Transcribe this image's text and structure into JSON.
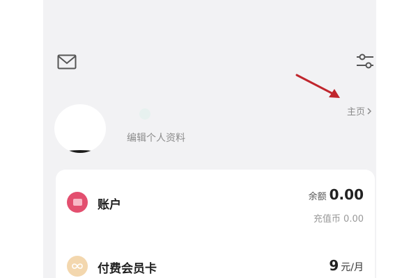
{
  "header": {
    "mail_icon": "mail-icon",
    "settings_icon": "sliders-icon",
    "homepage_label": "主页"
  },
  "profile": {
    "edit_label": "编辑个人资料"
  },
  "account": {
    "title": "账户",
    "balance_label": "余额",
    "balance_value": "0.00",
    "coins_label": "充值币",
    "coins_value": "0.00"
  },
  "membership": {
    "title": "付费会员卡",
    "price_value": "9",
    "price_unit": "元/月"
  },
  "colors": {
    "annotation_arrow": "#c0262d",
    "account_icon": "#e34f6f",
    "member_icon": "#f3d7ae"
  }
}
